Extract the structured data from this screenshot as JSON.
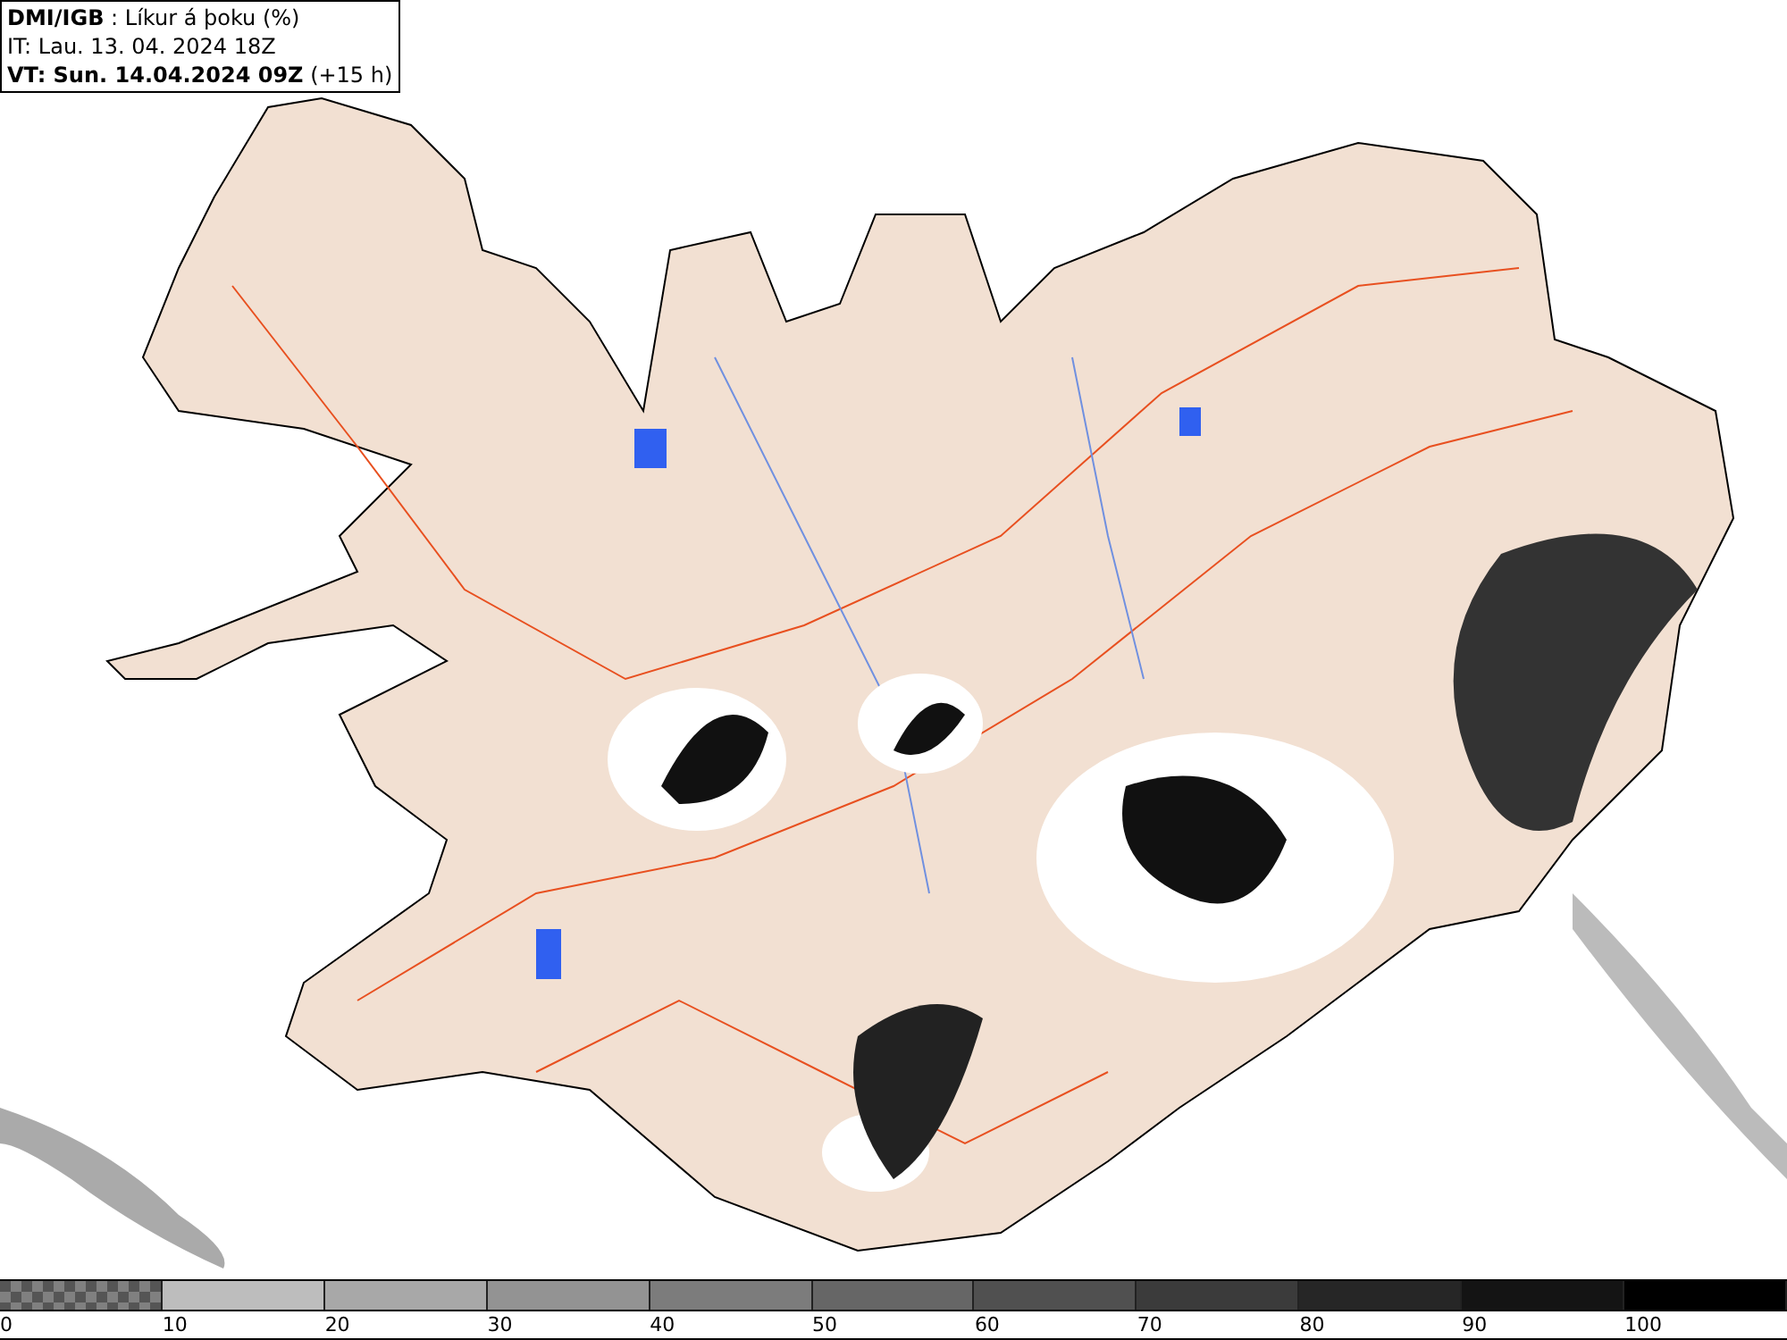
{
  "header": {
    "lines": [
      "**DMI/IGB** : Líkur á þoku (%)",
      "IT: Lau. 13. 04. 2024 18Z",
      "**VT: Sun. 14.04.2024 09Z** (+15 h)"
    ]
  },
  "legend": {
    "bins": [
      {
        "kind": "checker",
        "color": "#808080"
      },
      {
        "kind": "solid",
        "color": "#bdbdbd"
      },
      {
        "kind": "solid",
        "color": "#a8a8a8"
      },
      {
        "kind": "solid",
        "color": "#939393"
      },
      {
        "kind": "solid",
        "color": "#7c7c7c"
      },
      {
        "kind": "solid",
        "color": "#666666"
      },
      {
        "kind": "solid",
        "color": "#505050"
      },
      {
        "kind": "solid",
        "color": "#3b3b3b"
      },
      {
        "kind": "solid",
        "color": "#262626"
      },
      {
        "kind": "solid",
        "color": "#141414"
      },
      {
        "kind": "solid",
        "color": "#000000"
      }
    ],
    "ticks": [
      "0",
      "10",
      "20",
      "30",
      "40",
      "50",
      "60",
      "70",
      "80",
      "90",
      "100"
    ]
  }
}
